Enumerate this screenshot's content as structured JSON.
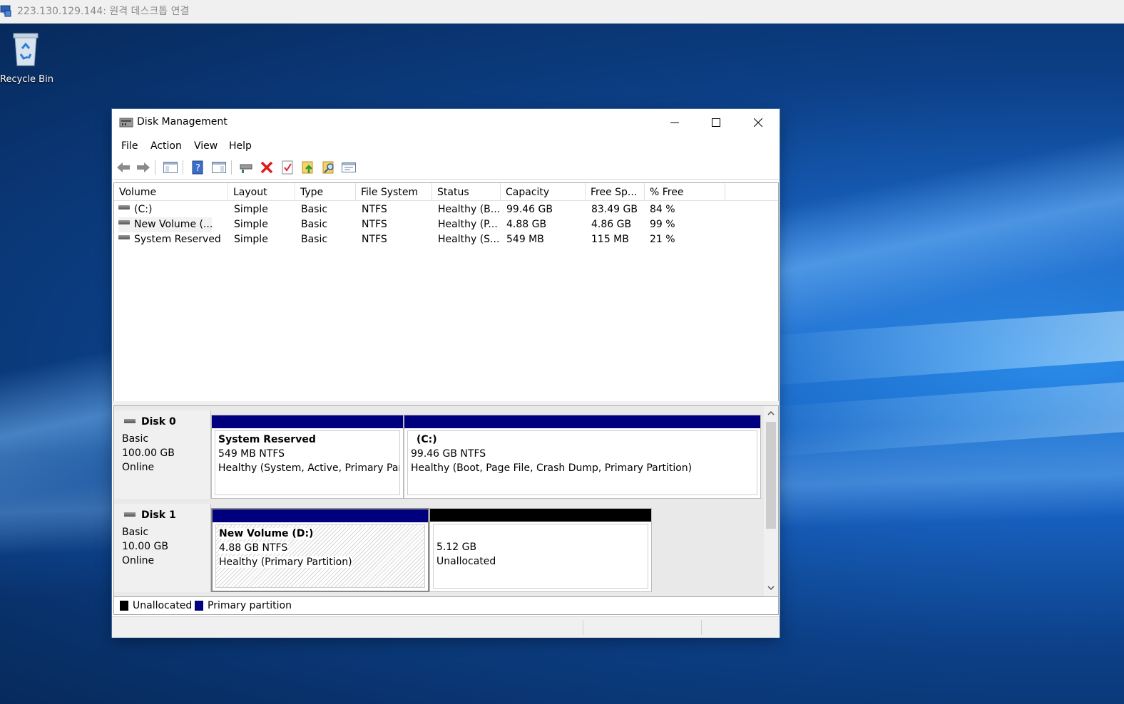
{
  "rdp": {
    "title": "223.130.129.144: 원격 데스크톱 연결"
  },
  "desktop": {
    "recycle_bin_label": "Recycle Bin"
  },
  "window": {
    "title": "Disk Management",
    "menu": [
      "File",
      "Action",
      "View",
      "Help"
    ],
    "toolbar_icons": [
      "back-icon",
      "forward-icon",
      "show-hide-console-tree-icon",
      "help-icon",
      "show-hide-action-pane-icon",
      "connect-virtual-disk-icon",
      "delete-icon",
      "check-icon",
      "export-list-icon",
      "properties-search-icon",
      "rescan-disks-icon"
    ]
  },
  "volume_list": {
    "columns": [
      "Volume",
      "Layout",
      "Type",
      "File System",
      "Status",
      "Capacity",
      "Free Sp...",
      "% Free"
    ],
    "rows": [
      [
        "(C:)",
        "Simple",
        "Basic",
        "NTFS",
        "Healthy (B...",
        "99.46 GB",
        "83.49 GB",
        "84 %"
      ],
      [
        "New Volume (...",
        "Simple",
        "Basic",
        "NTFS",
        "Healthy (P...",
        "4.88 GB",
        "4.86 GB",
        "99 %"
      ],
      [
        "System Reserved",
        "Simple",
        "Basic",
        "NTFS",
        "Healthy (S...",
        "549 MB",
        "115 MB",
        "21 %"
      ]
    ]
  },
  "disks": [
    {
      "name": "Disk 0",
      "type": "Basic",
      "size": "100.00 GB",
      "state": "Online",
      "partitions": [
        {
          "title": "System Reserved",
          "size": "549 MB NTFS",
          "status": "Healthy (System, Active, Primary Partit",
          "kind": "primary"
        },
        {
          "title": "(C:)",
          "size": "99.46 GB NTFS",
          "status": "Healthy (Boot, Page File, Crash Dump, Primary Partition)",
          "kind": "primary"
        }
      ]
    },
    {
      "name": "Disk 1",
      "type": "Basic",
      "size": "10.00 GB",
      "state": "Online",
      "partitions": [
        {
          "title": "New Volume  (D:)",
          "size": "4.88 GB NTFS",
          "status": "Healthy (Primary Partition)",
          "kind": "primary"
        },
        {
          "title": "",
          "size": "5.12 GB",
          "status": "Unallocated",
          "kind": "unallocated"
        }
      ]
    }
  ],
  "legend": {
    "unallocated": "Unallocated",
    "primary": "Primary partition"
  },
  "colors": {
    "primary": "#00007f",
    "unallocated": "#000000",
    "accent": "#0078d7"
  }
}
